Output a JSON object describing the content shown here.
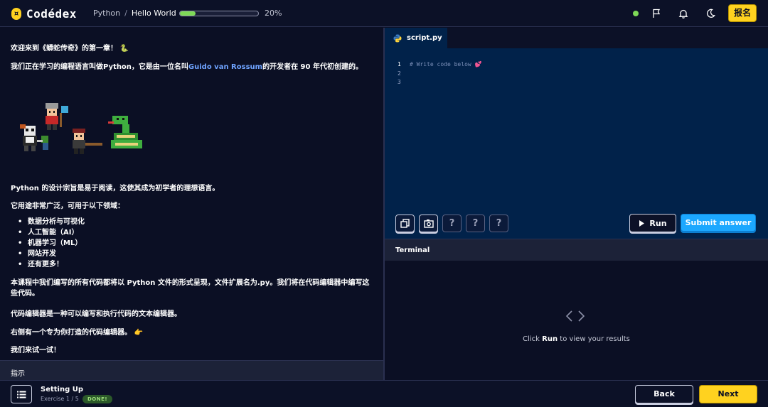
{
  "header": {
    "logo_text": "Codédex",
    "breadcrumb_course": "Python",
    "breadcrumb_separator": "/",
    "breadcrumb_lesson": "Hello World",
    "progress_percent": 20,
    "progress_text": "20%",
    "signup_label": "报名",
    "icons": [
      "flag-icon",
      "bell-icon",
      "moon-icon"
    ]
  },
  "lesson": {
    "intro": "欢迎来到《蟒蛇传奇》的第一章！",
    "p1_prefix": "我们正在学习的编程语言叫做Python，它是由一位名叫",
    "p1_link": "Guido van Rossum",
    "p1_suffix": "的开发者在 90 年代初创建的。",
    "p2": "Python 的设计宗旨是易于阅读，这使其成为初学者的理想语言。",
    "p3": "它用途非常广泛，可用于以下领域：",
    "uses": [
      "数据分析与可视化",
      "人工智能（AI）",
      "机器学习（ML）",
      "网站开发",
      "还有更多！"
    ],
    "p4": "本课程中我们编写的所有代码都将以 Python 文件的形式呈现，文件扩展名为.py。我们将在代码编辑器中编写这些代码。",
    "p5": "代码编辑器是一种可以编写和执行代码的文本编辑器。",
    "p6": "右侧有一个专为你打造的代码编辑器。",
    "p7": "我们来试一试！",
    "instructions_label": "指示"
  },
  "editor": {
    "tab_label": "script.py",
    "line_numbers": [
      "1",
      "2",
      "3"
    ],
    "code_line_1": "# Write code below",
    "tools": [
      "copy-icon",
      "screenshot-icon",
      "?",
      "?",
      "?"
    ],
    "run_label": "Run",
    "submit_label": "Submit answer"
  },
  "terminal": {
    "title": "Terminal",
    "hint_prefix": "Click ",
    "hint_run": "Run",
    "hint_suffix": " to view your results"
  },
  "footer": {
    "exercise_title": "Setting Up",
    "exercise_count": "Exercise 1 / 5",
    "done_badge": "DONE!",
    "back_label": "Back",
    "next_label": "Next"
  },
  "colors": {
    "accent_yellow": "#ffd21f",
    "progress_green": "#7ed957",
    "submit_blue": "#1ca8ff",
    "editor_bg": "#01224a",
    "page_bg": "#0b0f24"
  }
}
